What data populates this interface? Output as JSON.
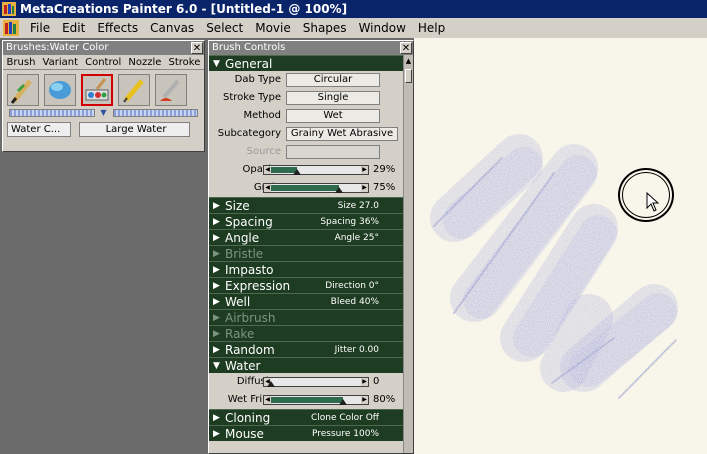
{
  "window": {
    "title": "MetaCreations Painter 6.0 - [Untitled-1 @ 100%]"
  },
  "menu": [
    "File",
    "Edit",
    "Effects",
    "Canvas",
    "Select",
    "Movie",
    "Shapes",
    "Window",
    "Help"
  ],
  "brushes_palette": {
    "title": "Brushes:Water Color",
    "tabs": [
      "Brush",
      "Variant",
      "Control",
      "Nozzle",
      "Stroke"
    ],
    "icons": [
      "felt-pen-icon",
      "cloud-brush-icon",
      "water-color-icon",
      "pencil-icon",
      "airbrush-icon"
    ],
    "brush_field": "Water C...",
    "variant_field": "Large Water"
  },
  "controls_palette": {
    "title": "Brush Controls",
    "general": {
      "label": "General",
      "dab_type_label": "Dab Type",
      "dab_type": "Circular",
      "stroke_type_label": "Stroke Type",
      "stroke_type": "Single",
      "method_label": "Method",
      "method": "Wet",
      "subcategory_label": "Subcategory",
      "subcategory": "Grainy Wet Abrasive",
      "source_label": "Source",
      "opacity_label": "Opacity",
      "opacity_text": "29%",
      "opacity": 0.29,
      "grain_label": "Grain",
      "grain_text": "75%",
      "grain": 0.75
    },
    "sections": [
      {
        "label": "Size",
        "summary": "Size 27.0",
        "disabled": false
      },
      {
        "label": "Spacing",
        "summary": "Spacing 36%",
        "disabled": false
      },
      {
        "label": "Angle",
        "summary": "Angle 25°",
        "disabled": false
      },
      {
        "label": "Bristle",
        "summary": "",
        "disabled": true
      },
      {
        "label": "Impasto",
        "summary": "",
        "disabled": false
      },
      {
        "label": "Expression",
        "summary": "Direction 0°",
        "disabled": false
      },
      {
        "label": "Well",
        "summary": "Bleed 40%",
        "disabled": false
      },
      {
        "label": "Airbrush",
        "summary": "",
        "disabled": true
      },
      {
        "label": "Rake",
        "summary": "",
        "disabled": true
      },
      {
        "label": "Random",
        "summary": "Jitter 0.00",
        "disabled": false
      }
    ],
    "water": {
      "label": "Water",
      "diffusion_label": "Diffusion",
      "diffusion_text": "0",
      "diffusion": 0.0,
      "wet_fringe_label": "Wet Fringe",
      "wet_fringe_text": "80%",
      "wet_fringe": 0.8
    },
    "bottom_sections": [
      {
        "label": "Cloning",
        "summary": "Clone Color Off",
        "disabled": false
      },
      {
        "label": "Mouse",
        "summary": "Pressure 100%",
        "disabled": false
      }
    ]
  },
  "colors": {
    "title_bar": "#0a246a",
    "section": "#1e3c22",
    "slider_fill": "#2e6a4e",
    "paint": "#6a70c8",
    "canvas": "#f8f6ea"
  }
}
